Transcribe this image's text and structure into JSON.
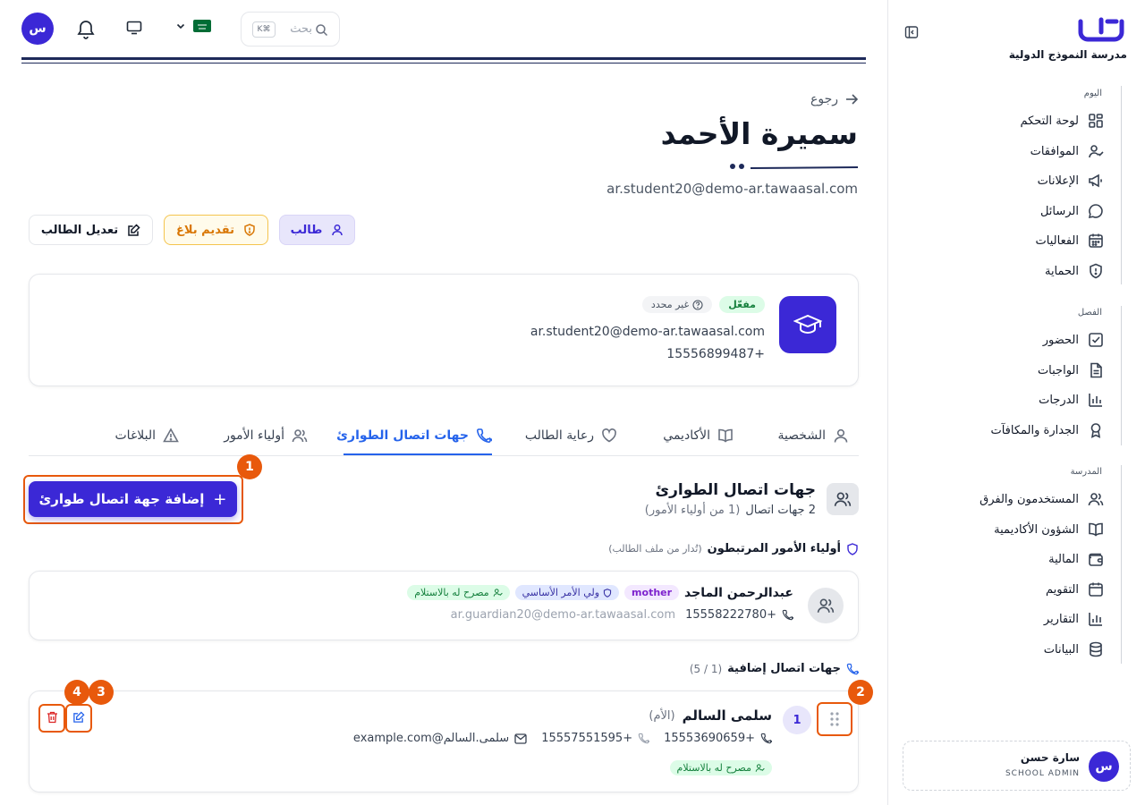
{
  "sidebar": {
    "school_name": "مدرسة النموذج الدولية",
    "sections": [
      {
        "title": "اليوم",
        "items": [
          {
            "label": "لوحة التحكم",
            "icon": "dashboard-icon"
          },
          {
            "label": "الموافقات",
            "icon": "user-check-icon"
          },
          {
            "label": "الإعلانات",
            "icon": "megaphone-icon"
          },
          {
            "label": "الرسائل",
            "icon": "message-icon"
          },
          {
            "label": "الفعاليات",
            "icon": "calendar-icon"
          },
          {
            "label": "الحماية",
            "icon": "shield-icon"
          }
        ]
      },
      {
        "title": "الفصل",
        "items": [
          {
            "label": "الحضور",
            "icon": "check-square-icon"
          },
          {
            "label": "الواجبات",
            "icon": "file-icon"
          },
          {
            "label": "الدرجات",
            "icon": "bar-chart-icon"
          },
          {
            "label": "الجدارة والمكافآت",
            "icon": "award-icon"
          }
        ]
      },
      {
        "title": "المدرسة",
        "items": [
          {
            "label": "المستخدمون والفرق",
            "icon": "users-icon"
          },
          {
            "label": "الشؤون الأكاديمية",
            "icon": "book-icon"
          },
          {
            "label": "المالية",
            "icon": "wallet-icon"
          },
          {
            "label": "التقويم",
            "icon": "calendar-icon"
          },
          {
            "label": "التقارير",
            "icon": "chart-icon"
          },
          {
            "label": "البيانات",
            "icon": "database-icon"
          }
        ]
      }
    ],
    "user": {
      "name": "سارة حسن",
      "role": "SCHOOL ADMIN",
      "avatar": "س"
    }
  },
  "topbar": {
    "avatar": "س",
    "search_placeholder": "بحث",
    "search_shortcut": "K⌘"
  },
  "header": {
    "back_label": "رجوع",
    "name": "سميرة الأحمد",
    "email": "ar.student20@demo-ar.tawaasal.com",
    "role_button": "طالب",
    "report_button": "تقديم بلاغ",
    "edit_button": "تعديل الطالب"
  },
  "profile_card": {
    "status_active": "مفعّل",
    "status_undefined": "غير محدد",
    "email": "ar.student20@demo-ar.tawaasal.com",
    "phone": "+15556899487"
  },
  "tabs": [
    {
      "label": "الشخصية",
      "icon": "user-icon"
    },
    {
      "label": "الأكاديمي",
      "icon": "book-icon"
    },
    {
      "label": "رعاية الطالب",
      "icon": "heart-icon"
    },
    {
      "label": "جهات اتصال الطوارئ",
      "icon": "phone-icon"
    },
    {
      "label": "أولياء الأمور",
      "icon": "users-icon"
    },
    {
      "label": "البلاغات",
      "icon": "alert-icon"
    }
  ],
  "emergency": {
    "title": "جهات اتصال الطوارئ",
    "subtitle_count": "2 جهات اتصال",
    "subtitle_extra": "(1 من أولياء الأمور)",
    "add_button": "إضافة جهة اتصال طوارئ",
    "linked_title": "أولياء الأمور المرتبطون",
    "linked_note": "(تُدار من ملف الطالب)",
    "guardian": {
      "name": "عبدالرحمن الماجد",
      "relation": "mother",
      "primary": "ولي الأمر الأساسي",
      "pickup": "مصرح له بالاستلام",
      "phone": "+15558222780",
      "email": "ar.guardian20@demo-ar.tawaasal.com"
    },
    "extra_title": "جهات اتصال إضافية",
    "extra_count": "(1 / 5)",
    "contact": {
      "index": "1",
      "name": "سلمى السالم",
      "relation": "(الأم)",
      "phone1": "+15553690659",
      "phone2": "+15557551595",
      "email": "سلمى.السالم@example.com",
      "pickup": "مصرح له بالاستلام"
    }
  },
  "annotations": [
    "1",
    "2",
    "3",
    "4"
  ],
  "colors": {
    "primary": "#3b28d6",
    "accent_orange": "#e8590c",
    "navy": "#1e2a5a"
  }
}
